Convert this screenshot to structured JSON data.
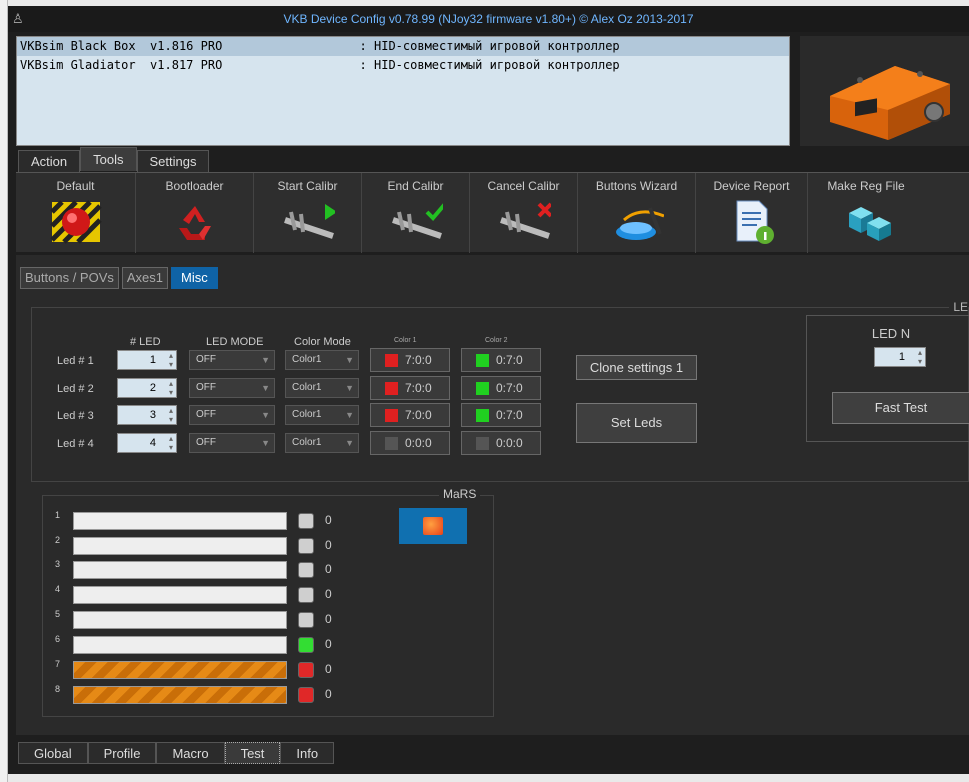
{
  "window": {
    "title": "VKB Device Config v0.78.99 (NJoy32 firmware v1.80+) © Alex Oz 2013-2017"
  },
  "devices": [
    {
      "text": "VKBsim Black Box  v1.816 PRO                   : HID-совместимый игровой контроллер"
    },
    {
      "text": "VKBsim Gladiator  v1.817 PRO                   : HID-совместимый игровой контроллер"
    }
  ],
  "top_tabs": [
    "Action",
    "Tools",
    "Settings"
  ],
  "toolbar": [
    {
      "label": "Default",
      "icon": "red-button-icon"
    },
    {
      "label": "Bootloader",
      "icon": "recycle-icon"
    },
    {
      "label": "Start Calibr",
      "icon": "caliper-play-icon"
    },
    {
      "label": "End Calibr",
      "icon": "caliper-check-icon"
    },
    {
      "label": "Cancel Calibr",
      "icon": "caliper-x-icon"
    },
    {
      "label": "Buttons Wizard",
      "icon": "wizard-button-icon"
    },
    {
      "label": "Device Report",
      "icon": "document-info-icon"
    },
    {
      "label": "Make Reg File",
      "icon": "cubes-icon"
    }
  ],
  "sub_tabs": [
    "Buttons / POVs",
    "Axes1",
    "Misc"
  ],
  "led_section": {
    "corner_label": "LE",
    "headers": {
      "led": "# LED",
      "mode": "LED MODE",
      "color_mode": "Color Mode",
      "color1": "Color 1",
      "color2": "Color 2"
    },
    "rows": [
      {
        "label": "Led # 1",
        "led": "1",
        "mode": "OFF",
        "color_mode": "Color1",
        "c1": "7:0:0",
        "c1_color": "#e02020",
        "c2": "0:7:0",
        "c2_color": "#20d020"
      },
      {
        "label": "Led # 2",
        "led": "2",
        "mode": "OFF",
        "color_mode": "Color1",
        "c1": "7:0:0",
        "c1_color": "#e02020",
        "c2": "0:7:0",
        "c2_color": "#20d020"
      },
      {
        "label": "Led # 3",
        "led": "3",
        "mode": "OFF",
        "color_mode": "Color1",
        "c1": "7:0:0",
        "c1_color": "#e02020",
        "c2": "0:7:0",
        "c2_color": "#20d020"
      },
      {
        "label": "Led # 4",
        "led": "4",
        "mode": "OFF",
        "color_mode": "Color1",
        "c1": "0:0:0",
        "c1_color": "#555555",
        "c2": "0:0:0",
        "c2_color": "#555555"
      }
    ],
    "clone_btn": "Clone settings 1",
    "set_leds_btn": "Set Leds"
  },
  "led_n": {
    "title": "LED N",
    "value": "1",
    "fast_test_btn": "Fast Test"
  },
  "mars": {
    "title": "MaRS",
    "rows": [
      {
        "num": "1",
        "value": "0",
        "active": false,
        "dot_color": "#cfcfcf"
      },
      {
        "num": "2",
        "value": "0",
        "active": false,
        "dot_color": "#cfcfcf"
      },
      {
        "num": "3",
        "value": "0",
        "active": false,
        "dot_color": "#cfcfcf"
      },
      {
        "num": "4",
        "value": "0",
        "active": false,
        "dot_color": "#cfcfcf"
      },
      {
        "num": "5",
        "value": "0",
        "active": false,
        "dot_color": "#cfcfcf"
      },
      {
        "num": "6",
        "value": "0",
        "active": false,
        "dot_color": "#33dd33"
      },
      {
        "num": "7",
        "value": "0",
        "active": true,
        "dot_color": "#e02828"
      },
      {
        "num": "8",
        "value": "0",
        "active": true,
        "dot_color": "#e02828"
      }
    ]
  },
  "bottom_tabs": [
    "Global",
    "Profile",
    "Macro",
    "Test",
    "Info"
  ],
  "colors": {
    "accent": "#0f63a6",
    "title_text": "#6fb6ff"
  }
}
